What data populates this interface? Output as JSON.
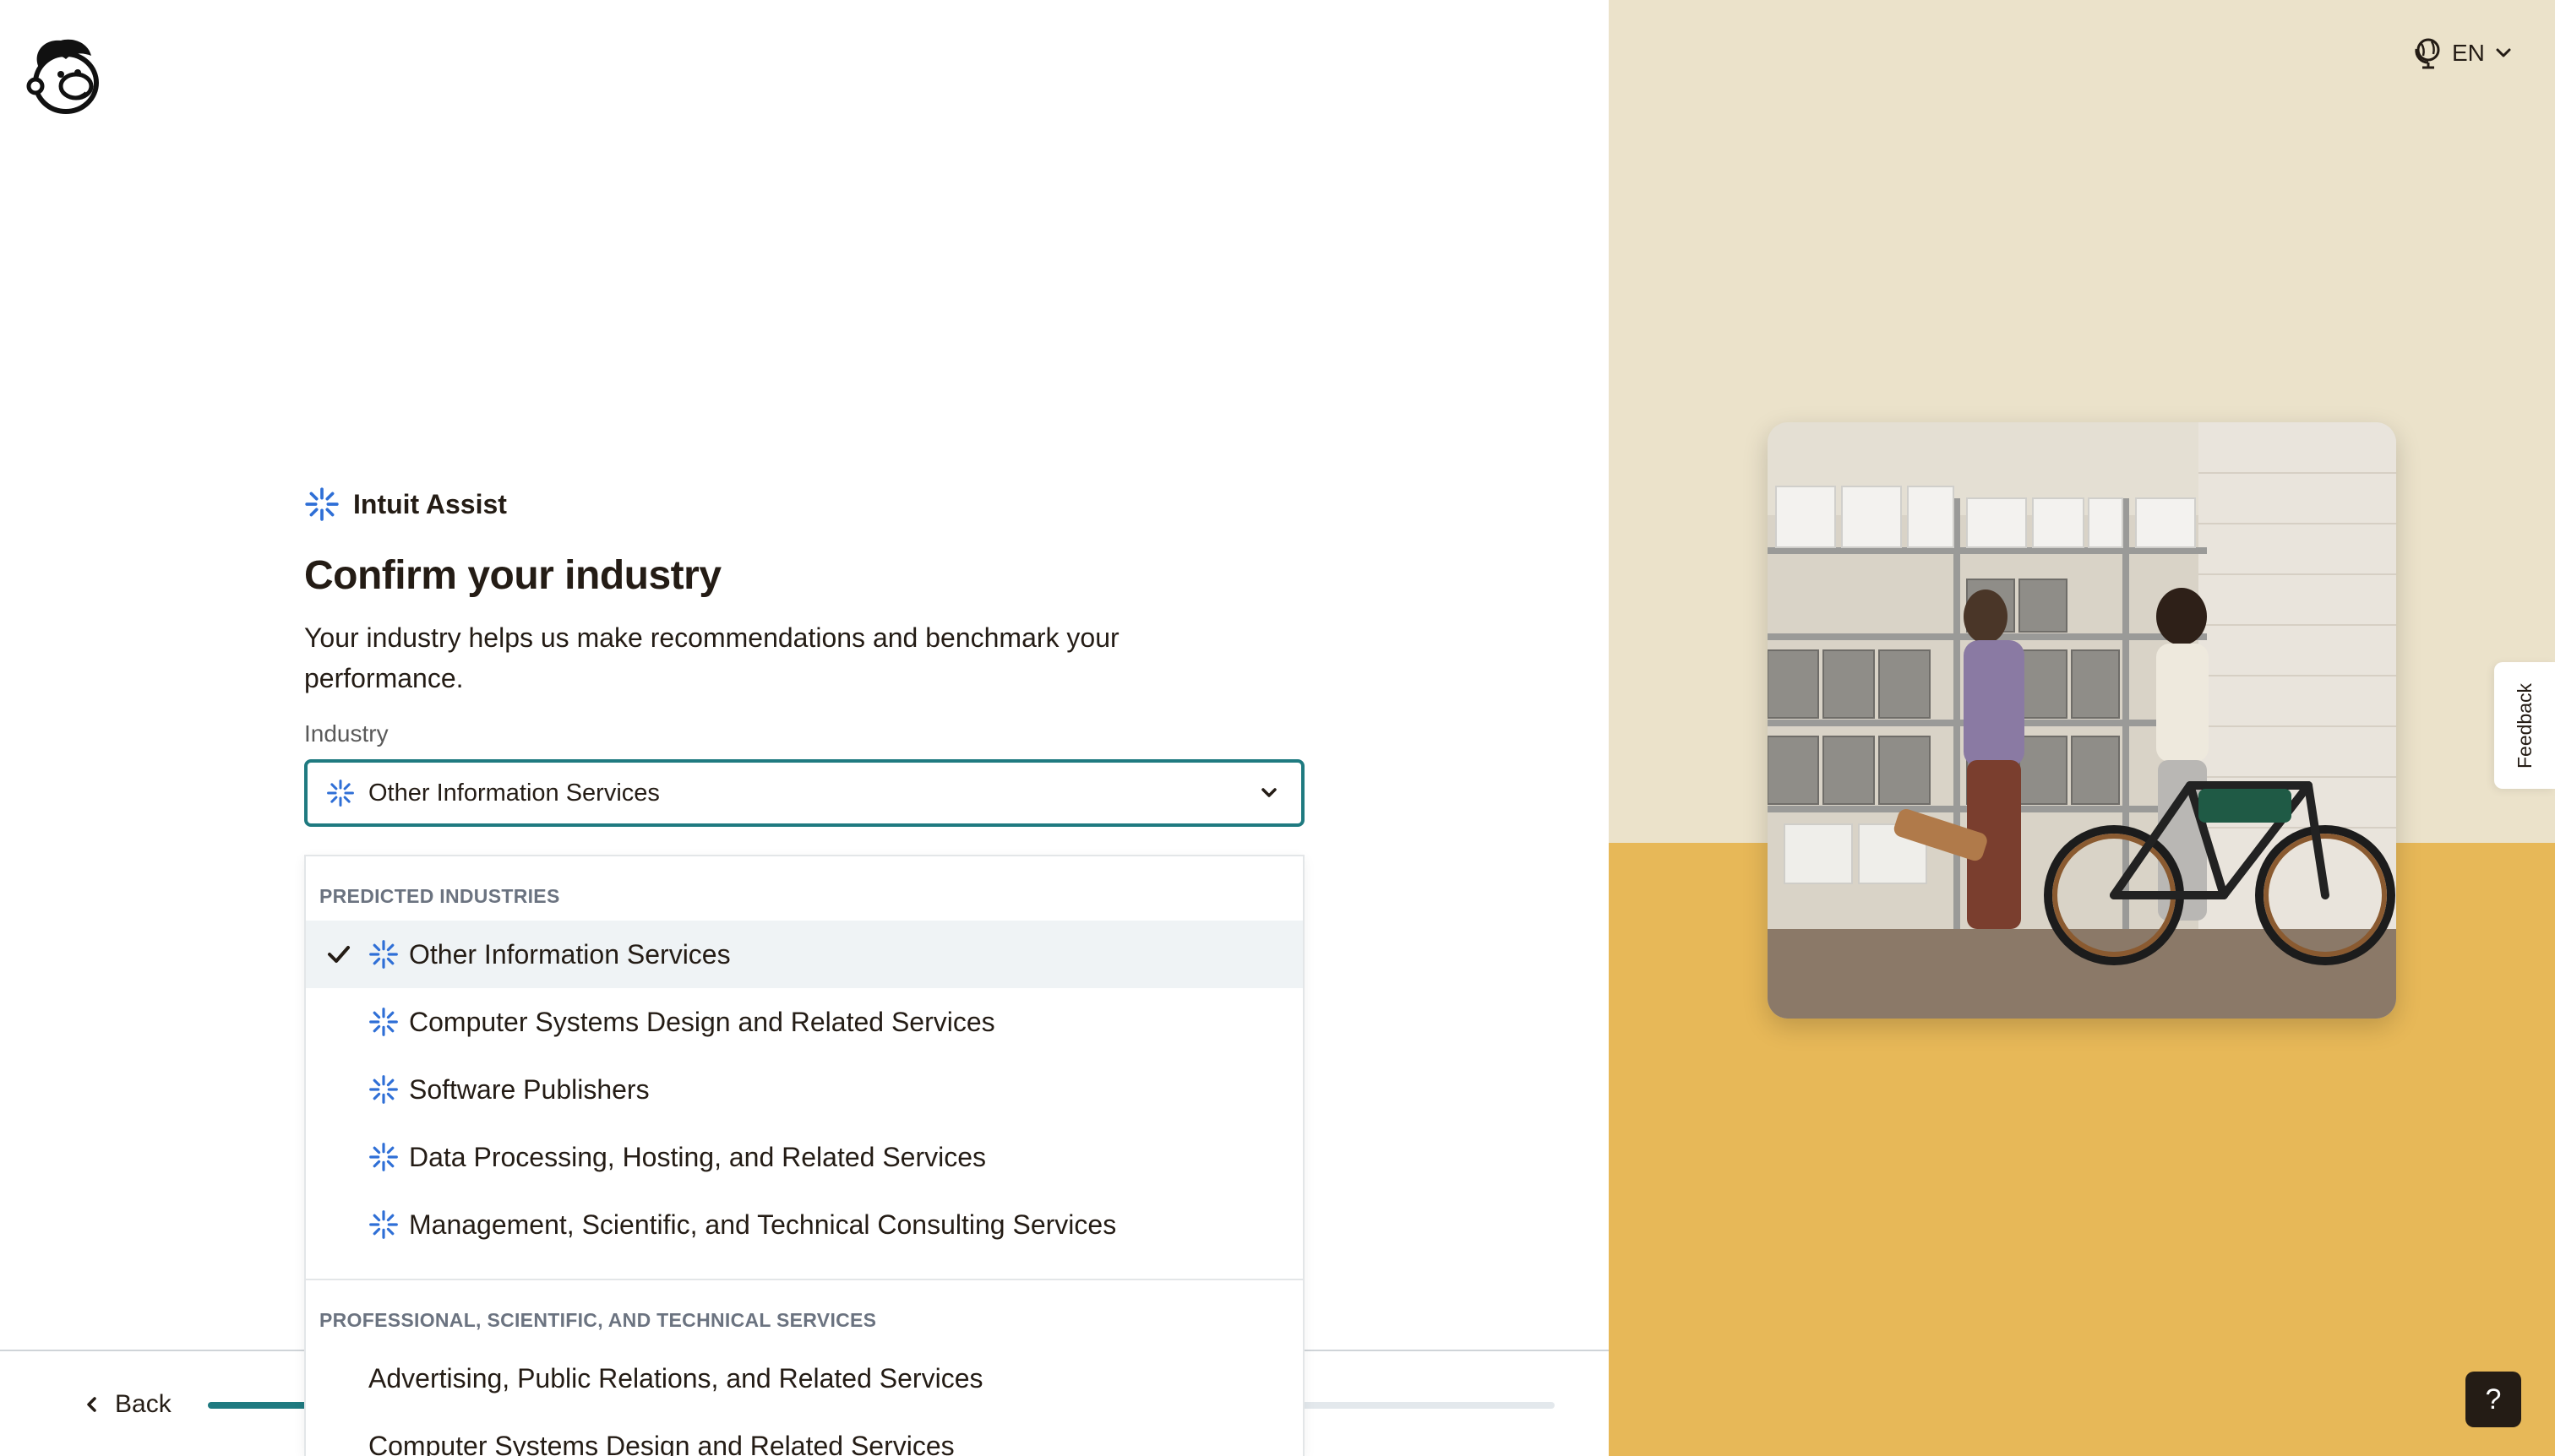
{
  "language": {
    "label": "EN"
  },
  "form": {
    "assist_label": "Intuit Assist",
    "title": "Confirm your industry",
    "description": "Your industry helps us make recommendations and benchmark your performance.",
    "field_label": "Industry",
    "selected_value": "Other Information Services"
  },
  "dropdown": {
    "groups": [
      {
        "header": "PREDICTED INDUSTRIES",
        "options": [
          {
            "label": "Other Information Services",
            "selected": true
          },
          {
            "label": "Computer Systems Design and Related Services"
          },
          {
            "label": "Software Publishers"
          },
          {
            "label": "Data Processing, Hosting, and Related Services"
          },
          {
            "label": "Management, Scientific, and Technical Consulting Services"
          }
        ]
      },
      {
        "header": "PROFESSIONAL, SCIENTIFIC, AND TECHNICAL SERVICES",
        "options": [
          {
            "label": "Advertising, Public Relations, and Related Services"
          },
          {
            "label": "Computer Systems Design and Related Services"
          }
        ]
      }
    ]
  },
  "footer": {
    "back_label": "Back",
    "progress_fraction": 0.09
  },
  "feedback": {
    "label": "Feedback"
  },
  "help": {
    "label": "?"
  },
  "colors": {
    "accent": "#1f7a80",
    "assist_blue": "#2f6fd6",
    "right_top": "#ebe2ca",
    "right_bottom": "#e7b858"
  },
  "icons": {
    "logo": "mailchimp-freddie-icon",
    "assist": "sparkle-icon",
    "language": "globe-icon",
    "chevron": "chevron-down-icon",
    "check": "check-icon",
    "back": "chevron-left-icon"
  }
}
